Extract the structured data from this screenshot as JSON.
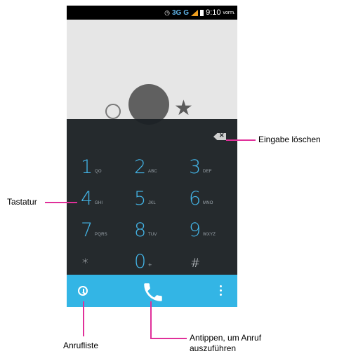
{
  "status_bar": {
    "network": "3G",
    "network2": "G",
    "time": "9:10",
    "ampm": "vorm."
  },
  "dialpad": {
    "keys": [
      {
        "num": "1",
        "letters": "QO"
      },
      {
        "num": "2",
        "letters": "ABC"
      },
      {
        "num": "3",
        "letters": "DEF"
      },
      {
        "num": "4",
        "letters": "GHI"
      },
      {
        "num": "5",
        "letters": "JKL"
      },
      {
        "num": "6",
        "letters": "MNO"
      },
      {
        "num": "7",
        "letters": "PQRS"
      },
      {
        "num": "8",
        "letters": "TUV"
      },
      {
        "num": "9",
        "letters": "WXYZ"
      },
      {
        "num": "*",
        "letters": ""
      },
      {
        "num": "0",
        "letters": "+"
      },
      {
        "num": "#",
        "letters": ""
      }
    ]
  },
  "annotations": {
    "delete_input": "Eingabe löschen",
    "keypad": "Tastatur",
    "call_log": "Anrufliste",
    "place_call_line1": "Antippen, um Anruf",
    "place_call_line2": "auszuführen"
  },
  "colors": {
    "accent": "#33b5e5",
    "digit": "#3bb2e6",
    "callout": "#e0309a",
    "dialer_bg": "#1b2024"
  },
  "icons": [
    "backspace-icon",
    "call-log-icon",
    "phone-call-icon",
    "overflow-menu-icon",
    "star-icon",
    "history-icon",
    "contact-avatar"
  ]
}
